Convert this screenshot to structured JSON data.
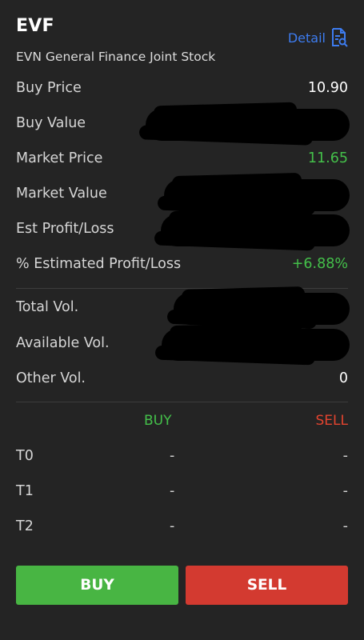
{
  "header": {
    "symbol": "EVF",
    "company": "EVN General Finance Joint Stock",
    "detail_label": "Detail"
  },
  "summary": [
    {
      "label": "Buy Price",
      "value": "10.90",
      "redacted": false,
      "color": "#ffffff"
    },
    {
      "label": "Buy Value",
      "value": "",
      "redacted": true
    },
    {
      "label": "Market Price",
      "value": "11.65",
      "redacted": false,
      "color": "#44c04a"
    },
    {
      "label": "Market Value",
      "value": "",
      "redacted": true
    },
    {
      "label": "Est Profit/Loss",
      "value": "",
      "redacted": true
    },
    {
      "label": "% Estimated Profit/Loss",
      "value": "+6.88%",
      "redacted": false,
      "color": "#44c04a"
    }
  ],
  "volume": [
    {
      "label": "Total Vol.",
      "value": "",
      "redacted": true
    },
    {
      "label": "Available Vol.",
      "value": "",
      "redacted": true
    },
    {
      "label": "Other Vol.",
      "value": "0",
      "redacted": false
    }
  ],
  "settlement": {
    "buy_header": "BUY",
    "sell_header": "SELL",
    "rows": [
      {
        "label": "T0",
        "buy": "-",
        "sell": "-"
      },
      {
        "label": "T1",
        "buy": "-",
        "sell": "-"
      },
      {
        "label": "T2",
        "buy": "-",
        "sell": "-"
      }
    ]
  },
  "actions": {
    "buy_label": "BUY",
    "sell_label": "SELL"
  },
  "colors": {
    "background": "#242424",
    "accent_link": "#3d7cf0",
    "positive": "#44c04a",
    "negative": "#e3442f",
    "buy_button": "#48b543",
    "sell_button": "#d33a30"
  }
}
